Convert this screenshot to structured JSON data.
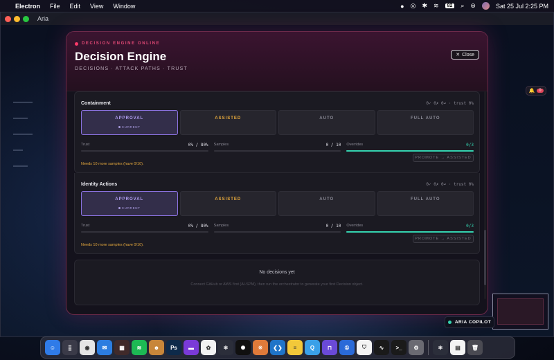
{
  "menubar": {
    "app_name": "Electron",
    "menus": [
      "File",
      "Edit",
      "View",
      "Window"
    ],
    "date_time": "Sat 25 Jul  2:25 PM",
    "battery_label": "82"
  },
  "window": {
    "title": "Aria"
  },
  "bell": {
    "count": "0"
  },
  "modal": {
    "status": "DECISION ENGINE ONLINE",
    "title": "Decision Engine",
    "subtitle": "DECISIONS · ATTACK PATHS · TRUST",
    "close_label": "Close",
    "sections": [
      {
        "title": "Containment",
        "stats": "0✓ 0✗ 0↩ · trust 0%",
        "tiers": [
          "APPROVAL",
          "ASSISTED",
          "AUTO",
          "FULL AUTO"
        ],
        "current_label": "CURRENT",
        "trust_label": "Trust",
        "trust_value": "0% / 80%",
        "trust_fraction": 0,
        "samples_label": "Samples",
        "samples_value": "0 / 10",
        "samples_fraction": 0,
        "overrides_label": "Overrides",
        "overrides_value": "0/3",
        "overrides_fraction": 1,
        "note": "Needs 10 more samples (have 0/10).",
        "promote_label": "PROMOTE → ASSISTED"
      },
      {
        "title": "Identity Actions",
        "stats": "0✓ 0✗ 0↩ · trust 0%",
        "tiers": [
          "APPROVAL",
          "ASSISTED",
          "AUTO",
          "FULL AUTO"
        ],
        "current_label": "CURRENT",
        "trust_label": "Trust",
        "trust_value": "0% / 80%",
        "trust_fraction": 0,
        "samples_label": "Samples",
        "samples_value": "0 / 10",
        "samples_fraction": 0,
        "overrides_label": "Overrides",
        "overrides_value": "0/3",
        "overrides_fraction": 1,
        "note": "Needs 10 more samples (have 0/10).",
        "promote_label": "PROMOTE → ASSISTED"
      }
    ],
    "empty": {
      "title": "No decisions yet",
      "description": "Connect GitHub or AWS first (AI-SPM), then run the orchestrator to generate your first Decision object."
    }
  },
  "copilot": {
    "label": "ARIA COPILOT"
  },
  "dock": {
    "icons": [
      {
        "name": "finder-icon",
        "color": "#2f7be8",
        "glyph": "☺"
      },
      {
        "name": "launchpad-icon",
        "color": "#3a3a48",
        "glyph": "⣿"
      },
      {
        "name": "chrome-icon",
        "color": "#e5e5e5",
        "glyph": "◉"
      },
      {
        "name": "mail-icon",
        "color": "#2c7de0",
        "glyph": "✉"
      },
      {
        "name": "calendar-grid-icon",
        "color": "#402a2a",
        "glyph": "▦"
      },
      {
        "name": "spotify-icon",
        "color": "#1db954",
        "glyph": "≋"
      },
      {
        "name": "character-icon",
        "color": "#c8863a",
        "glyph": "☻"
      },
      {
        "name": "photoshop-icon",
        "color": "#0e2a4a",
        "glyph": "Ps"
      },
      {
        "name": "purple-app-icon",
        "color": "#7a3ad8",
        "glyph": "▬"
      },
      {
        "name": "photos-icon",
        "color": "#f2f2f2",
        "glyph": "✿"
      },
      {
        "name": "electron-icon",
        "color": "#2b2e3a",
        "glyph": "⚛"
      },
      {
        "name": "chatgpt-icon",
        "color": "#101010",
        "glyph": "✺"
      },
      {
        "name": "claude-icon",
        "color": "#e07a3a",
        "glyph": "✳"
      },
      {
        "name": "vscode-icon",
        "color": "#1f74c8",
        "glyph": "❮❯"
      },
      {
        "name": "notes-icon",
        "color": "#f2c83a",
        "glyph": "≡"
      },
      {
        "name": "quicktime-icon",
        "color": "#3aa0e8",
        "glyph": "Q"
      },
      {
        "name": "proton-icon",
        "color": "#6a4ad8",
        "glyph": "⊓"
      },
      {
        "name": "1password-icon",
        "color": "#2a6ad8",
        "glyph": "①"
      },
      {
        "name": "bitwarden-icon",
        "color": "#f4f4f4",
        "glyph": "⛉"
      },
      {
        "name": "activity-monitor-icon",
        "color": "#1a1a1a",
        "glyph": "∿"
      },
      {
        "name": "terminal-icon",
        "color": "#1a1a1a",
        "glyph": ">_"
      },
      {
        "name": "settings-icon",
        "color": "#6a6a72",
        "glyph": "⚙"
      },
      {
        "name": "electron-app-icon",
        "color": "#2b2e3a",
        "glyph": "⚛"
      },
      {
        "name": "document-icon",
        "color": "#f4f4f4",
        "glyph": "▤"
      },
      {
        "name": "trash-icon",
        "color": "#4a4a52",
        "glyph": "🗑"
      }
    ]
  },
  "colors": {
    "accent_pink": "#e34a76",
    "approval_purple": "#8b72e0",
    "assisted_amber": "#e6a93d",
    "teal": "#35d3b0"
  }
}
